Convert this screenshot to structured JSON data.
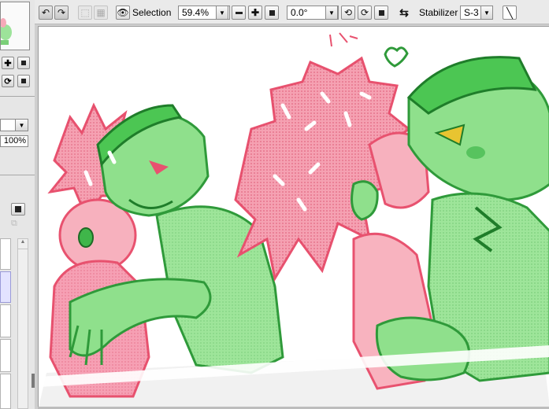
{
  "toolbar": {
    "undo_icon": "undo-icon",
    "redo_icon": "redo-icon",
    "selection_label": "Selection",
    "zoom_value": "59.4%",
    "angle_value": "0.0°",
    "stabilizer_label": "Stabilizer",
    "stabilizer_value": "S-3"
  },
  "layer_panel": {
    "opacity": "100%"
  },
  "colors": {
    "pink": "#e8526f",
    "pink_fill": "#f5a1b2",
    "green": "#3fb64a",
    "green_fill": "#8fe08c"
  }
}
